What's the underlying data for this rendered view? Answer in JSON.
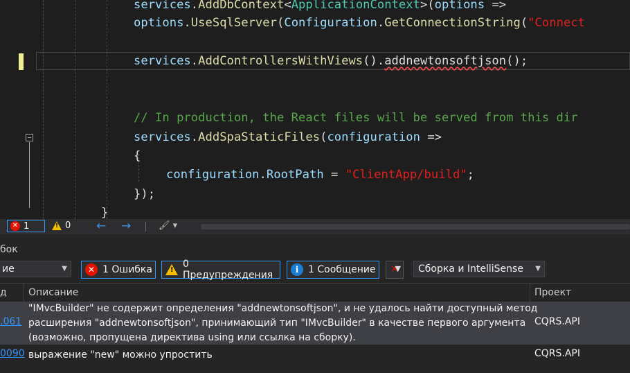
{
  "editor": {
    "lines": [
      {
        "tokens": [
          {
            "t": "services",
            "c": "k-param"
          },
          {
            "t": ".",
            "c": "k-punct"
          },
          {
            "t": "AddDbContext",
            "c": "k-method"
          },
          {
            "t": "<",
            "c": "k-punct"
          },
          {
            "t": "ApplicationContext",
            "c": "k-type"
          },
          {
            "t": ">(",
            "c": "k-punct"
          },
          {
            "t": "options",
            "c": "k-param"
          },
          {
            "t": " =>",
            "c": "k-punct"
          }
        ]
      },
      {
        "tokens": [
          {
            "t": "options",
            "c": "k-param"
          },
          {
            "t": ".",
            "c": "k-punct"
          },
          {
            "t": "UseSqlServer",
            "c": "k-method"
          },
          {
            "t": "(",
            "c": "k-punct"
          },
          {
            "t": "Configuration",
            "c": "k-param"
          },
          {
            "t": ".",
            "c": "k-punct"
          },
          {
            "t": "GetConnectionString",
            "c": "k-method"
          },
          {
            "t": "(",
            "c": "k-punct"
          },
          {
            "t": "\"Connect",
            "c": "k-str"
          }
        ]
      },
      {
        "tokens": [
          {
            "t": "services",
            "c": "k-param"
          },
          {
            "t": ".",
            "c": "k-punct"
          },
          {
            "t": "AddControllersWithViews",
            "c": "k-method"
          },
          {
            "t": "().",
            "c": "k-punct"
          },
          {
            "t": "addnewtonsoftjson",
            "c": "k-member squiggle"
          },
          {
            "t": "();",
            "c": "k-punct"
          }
        ]
      },
      {
        "tokens": [
          {
            "t": "// In production, the React files will be served from this dir",
            "c": "k-comment"
          }
        ]
      },
      {
        "tokens": [
          {
            "t": "services",
            "c": "k-param"
          },
          {
            "t": ".",
            "c": "k-punct"
          },
          {
            "t": "AddSpaStaticFiles",
            "c": "k-method"
          },
          {
            "t": "(",
            "c": "k-punct"
          },
          {
            "t": "configuration",
            "c": "k-param"
          },
          {
            "t": " =>",
            "c": "k-punct"
          }
        ]
      },
      {
        "tokens": [
          {
            "t": "{",
            "c": "k-punct"
          }
        ]
      },
      {
        "tokens": [
          {
            "t": "configuration",
            "c": "k-param"
          },
          {
            "t": ".",
            "c": "k-punct"
          },
          {
            "t": "RootPath",
            "c": "k-param"
          },
          {
            "t": " = ",
            "c": "k-punct"
          },
          {
            "t": "\"ClientApp/build\"",
            "c": "k-str"
          },
          {
            "t": ";",
            "c": "k-punct"
          }
        ]
      },
      {
        "tokens": [
          {
            "t": "});",
            "c": "k-punct"
          }
        ]
      },
      {
        "tokens": [
          {
            "t": "}",
            "c": "k-punct"
          }
        ]
      }
    ]
  },
  "status": {
    "errors": "1",
    "warnings": "0",
    "back_arrow": "←",
    "forward_arrow": "→",
    "brush_glyph": "🖌 ▾"
  },
  "panel": {
    "title": "бок",
    "scope_combo": "ие",
    "errors_filter": "1 Ошибка",
    "warnings_filter": "0 Предупреждения",
    "messages_filter": "1 Сообщение",
    "build_combo": "Сборка и IntelliSense",
    "columns": {
      "code": "д",
      "description": "Описание",
      "project": "Проект"
    },
    "rows": [
      {
        "code": ".061",
        "description": [
          "\"IMvcBuilder\" не содержит определения \"addnewtonsoftjson\", и не удалось найти доступный метод",
          "расширения \"addnewtonsoftjson\", принимающий тип \"IMvcBuilder\" в качестве первого аргумента",
          "(возможно, пропущена директива using или ссылка на сборку)."
        ],
        "project": "CQRS.API"
      },
      {
        "code": "0090",
        "description": [
          "выражение \"new\" можно упростить"
        ],
        "project": "CQRS.API"
      }
    ]
  }
}
